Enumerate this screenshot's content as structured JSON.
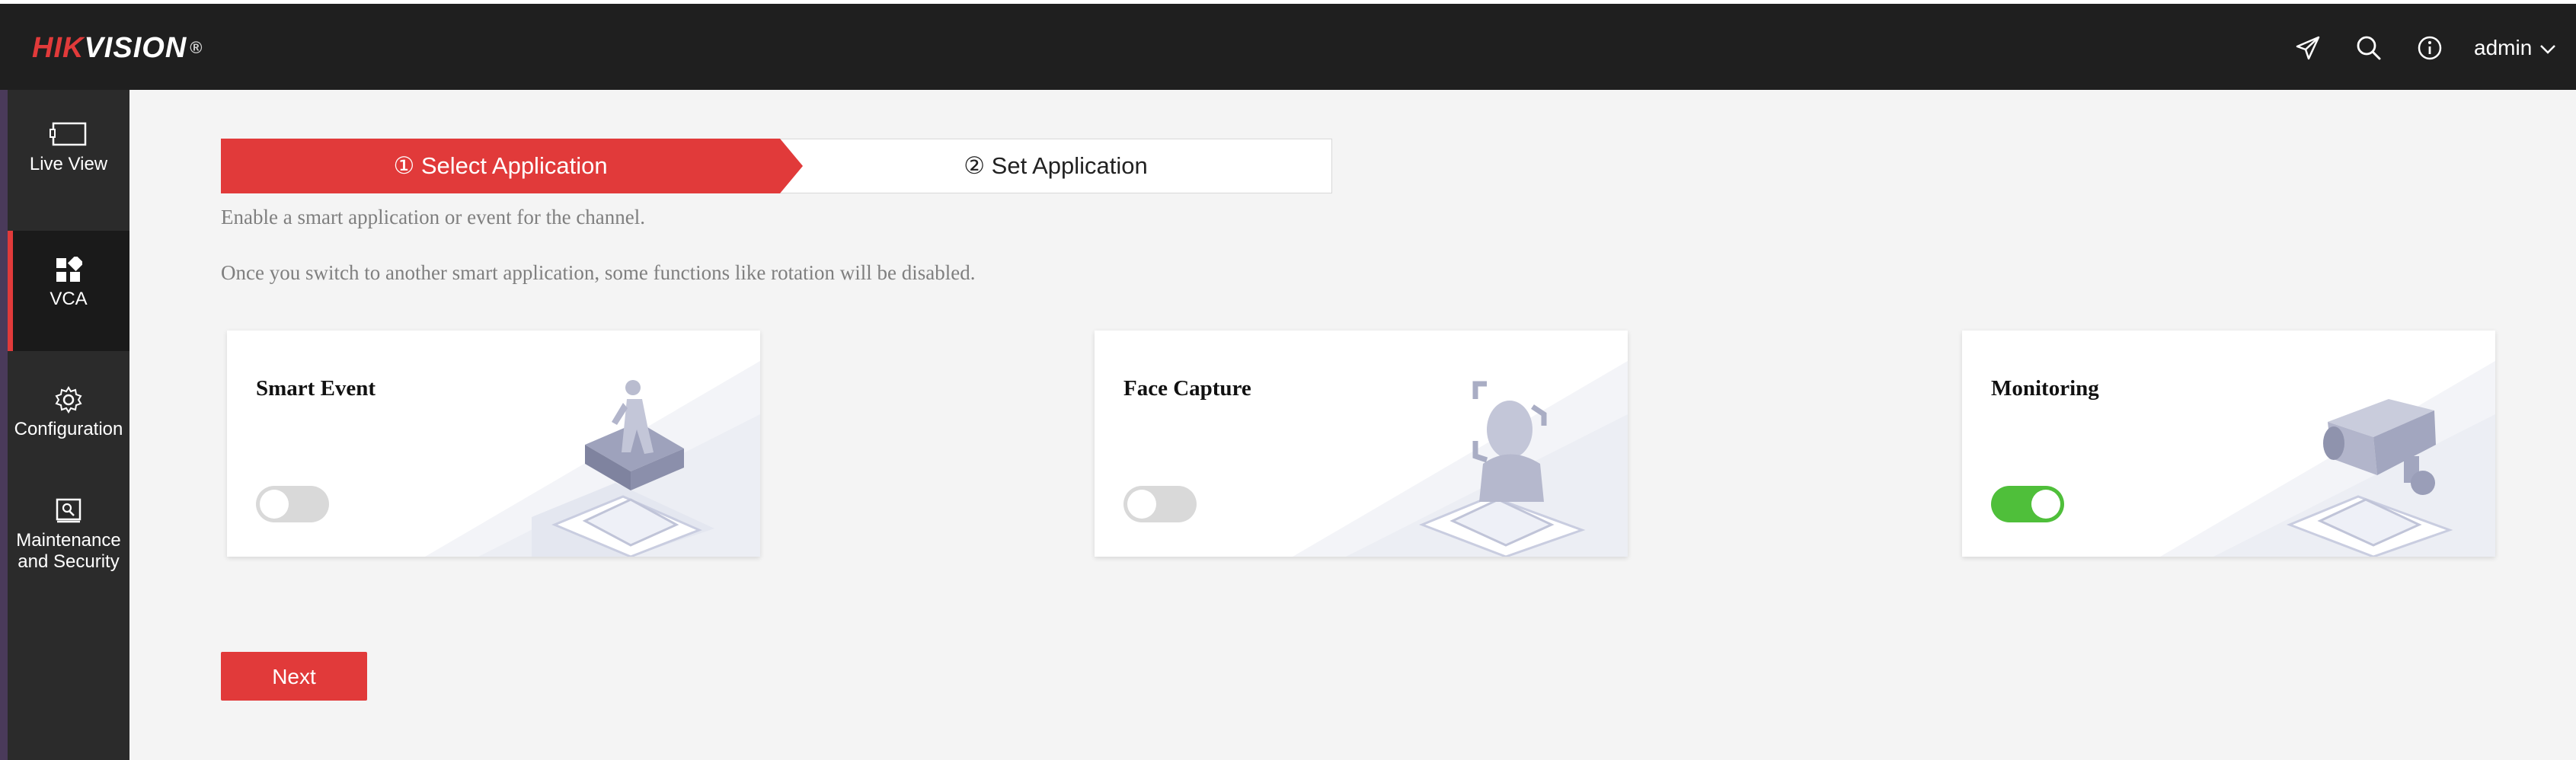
{
  "header": {
    "logo_red": "HIK",
    "logo_white": "VISION",
    "logo_mark": "®",
    "user": "admin",
    "icons": [
      "send-icon",
      "search-icon",
      "info-icon",
      "chevron-down-icon"
    ]
  },
  "sidebar": {
    "items": [
      {
        "label": "Live View",
        "icon": "monitor-icon"
      },
      {
        "label": "VCA",
        "icon": "grid-icon",
        "active": true
      },
      {
        "label": "Configuration",
        "icon": "gear-icon"
      },
      {
        "label": "Maintenance\nand Security",
        "line1": "Maintenance",
        "line2": "and Security",
        "icon": "maintenance-icon"
      }
    ]
  },
  "steps": [
    {
      "label": "① Select Application",
      "active": true
    },
    {
      "label": "② Set Application",
      "active": false
    }
  ],
  "description": {
    "line1": "Enable a smart application or event for the channel.",
    "line2": "Once you switch to another smart application, some functions like rotation will be disabled."
  },
  "cards": [
    {
      "title": "Smart Event",
      "enabled": false
    },
    {
      "title": "Face Capture",
      "enabled": false
    },
    {
      "title": "Monitoring",
      "enabled": true
    }
  ],
  "next_button": "Next",
  "colors": {
    "accent": "#e13a3a",
    "header_bg": "#1f1f1f",
    "sidebar_bg": "#2b2b2b",
    "toggle_on": "#4fbf3a",
    "toggle_off": "#d9d9d9"
  }
}
